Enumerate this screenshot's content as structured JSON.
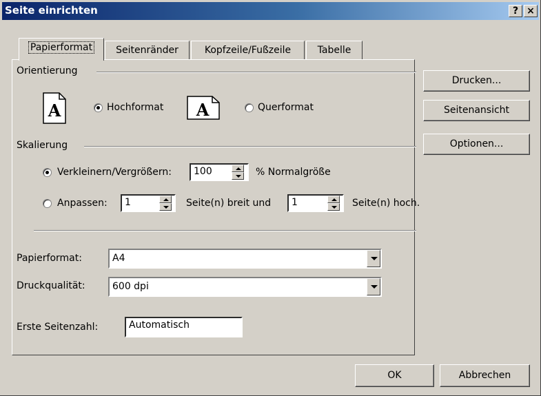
{
  "window": {
    "title": "Seite einrichten",
    "help_glyph": "?",
    "close_glyph": "×"
  },
  "tabs": [
    {
      "label": "Papierformat",
      "active": true
    },
    {
      "label": "Seitenränder",
      "active": false
    },
    {
      "label": "Kopfzeile/Fußzeile",
      "active": false
    },
    {
      "label": "Tabelle",
      "active": false
    }
  ],
  "orientation": {
    "group_label": "Orientierung",
    "portrait_label": "Hochformat",
    "landscape_label": "Querformat",
    "icon_glyph": "A",
    "selected": "portrait"
  },
  "scaling": {
    "group_label": "Skalierung",
    "reduce_label": "Verkleinern/Vergrößern:",
    "reduce_value": "100",
    "reduce_suffix": "% Normalgröße",
    "fit_label": "Anpassen:",
    "fit_wide_value": "1",
    "fit_wide_suffix": "Seite(n) breit und",
    "fit_tall_value": "1",
    "fit_tall_suffix": "Seite(n) hoch.",
    "selected": "reduce"
  },
  "paper": {
    "paper_size_label": "Papierformat:",
    "paper_size_value": "A4",
    "print_quality_label": "Druckqualität:",
    "print_quality_value": "600 dpi",
    "first_page_label": "Erste Seitenzahl:",
    "first_page_value": "Automatisch"
  },
  "side_buttons": {
    "print": "Drucken...",
    "preview": "Seitenansicht",
    "options": "Optionen..."
  },
  "footer": {
    "ok": "OK",
    "cancel": "Abbrechen"
  },
  "colors": {
    "face": "#d4d0c8",
    "title_start": "#0a246a",
    "title_end": "#a6caf0"
  }
}
